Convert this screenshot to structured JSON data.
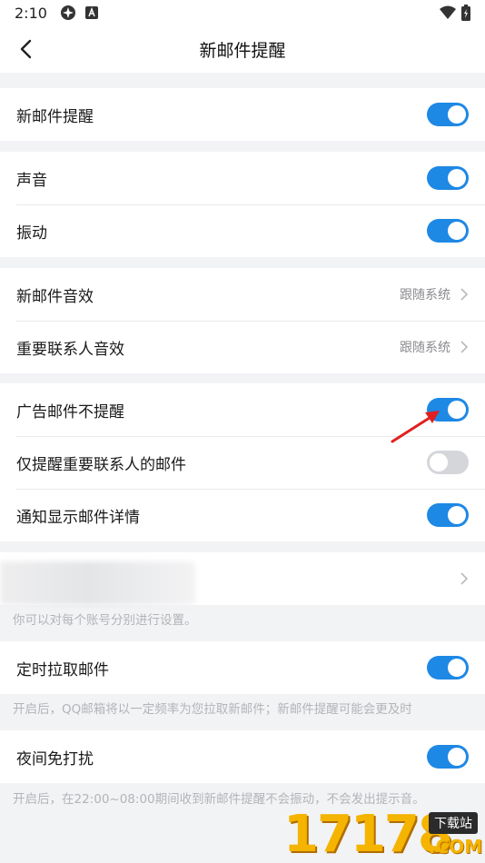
{
  "status_bar": {
    "time": "2:10"
  },
  "nav": {
    "title": "新邮件提醒"
  },
  "groups": {
    "g1": [
      {
        "label": "新邮件提醒",
        "on": true
      }
    ],
    "g2": [
      {
        "label": "声音",
        "on": true
      },
      {
        "label": "振动",
        "on": true
      }
    ],
    "g3": [
      {
        "label": "新邮件音效",
        "value": "跟随系统"
      },
      {
        "label": "重要联系人音效",
        "value": "跟随系统"
      }
    ],
    "g4": [
      {
        "label": "广告邮件不提醒",
        "on": true
      },
      {
        "label": "仅提醒重要联系人的邮件",
        "on": false
      },
      {
        "label": "通知显示邮件详情",
        "on": true
      }
    ],
    "g6": [
      {
        "label": "定时拉取邮件",
        "on": true
      }
    ],
    "g7": [
      {
        "label": "夜间免打扰",
        "on": true
      }
    ]
  },
  "hints": {
    "account": "你可以对每个账号分别进行设置。",
    "pull": "开启后，QQ邮箱将以一定频率为您拉取新邮件；新邮件提醒可能会更及时",
    "night": "开启后，在22:00~08:00期间收到新邮件提醒不会振动，不会发出提示音。"
  },
  "watermark": {
    "digits": "17178",
    "badge": "下载站",
    "domain": ".COM"
  },
  "colors": {
    "accent": "#1e88e5",
    "switch_off": "#d5d6da",
    "annotation": "#e02020"
  }
}
